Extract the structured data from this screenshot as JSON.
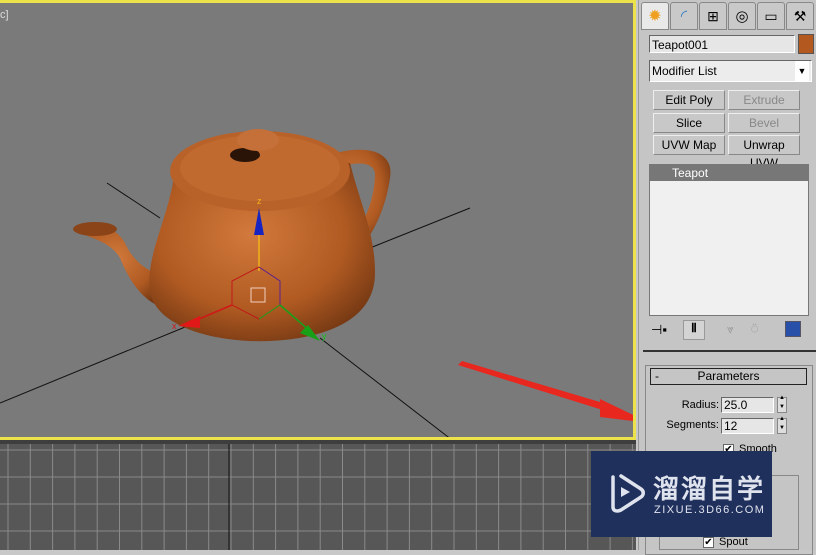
{
  "viewport": {
    "label": "c]",
    "object_color": "#b3591f",
    "gizmo_axes": [
      "x",
      "y",
      "z"
    ],
    "highlight_border_color": "#ece24a"
  },
  "command_panel": {
    "tabs": [
      {
        "name": "create",
        "icon": "sun-icon",
        "active": true
      },
      {
        "name": "modify",
        "icon": "curve-icon",
        "active": false
      },
      {
        "name": "hierarchy",
        "icon": "hierarchy-icon",
        "active": false
      },
      {
        "name": "motion",
        "icon": "motion-icon",
        "active": false
      },
      {
        "name": "display",
        "icon": "monitor-icon",
        "active": false
      },
      {
        "name": "utilities",
        "icon": "hammer-icon",
        "active": false
      }
    ],
    "object_name": "Teapot001",
    "object_color": "#b3591f",
    "modifier_list": "Modifier List",
    "buttons": [
      {
        "label": "Edit Poly",
        "enabled": true
      },
      {
        "label": "Extrude",
        "enabled": false
      },
      {
        "label": "Slice",
        "enabled": true
      },
      {
        "label": "Bevel",
        "enabled": false
      },
      {
        "label": "UVW Map",
        "enabled": true
      },
      {
        "label": "Unwrap UVW",
        "enabled": true
      }
    ],
    "stack": [
      "Teapot"
    ],
    "parameters": {
      "title": "Parameters",
      "collapse": "-",
      "radius_label": "Radius:",
      "radius": "25.0",
      "segments_label": "Segments:",
      "segments": "12",
      "smooth_label": "Smooth",
      "smooth": true,
      "spout_label": "Spout",
      "spout": true
    }
  },
  "watermark": {
    "title": "溜溜自学",
    "url": "ZIXUE.3D66.COM"
  },
  "annotation": {
    "arrow_color": "#e8281e"
  }
}
